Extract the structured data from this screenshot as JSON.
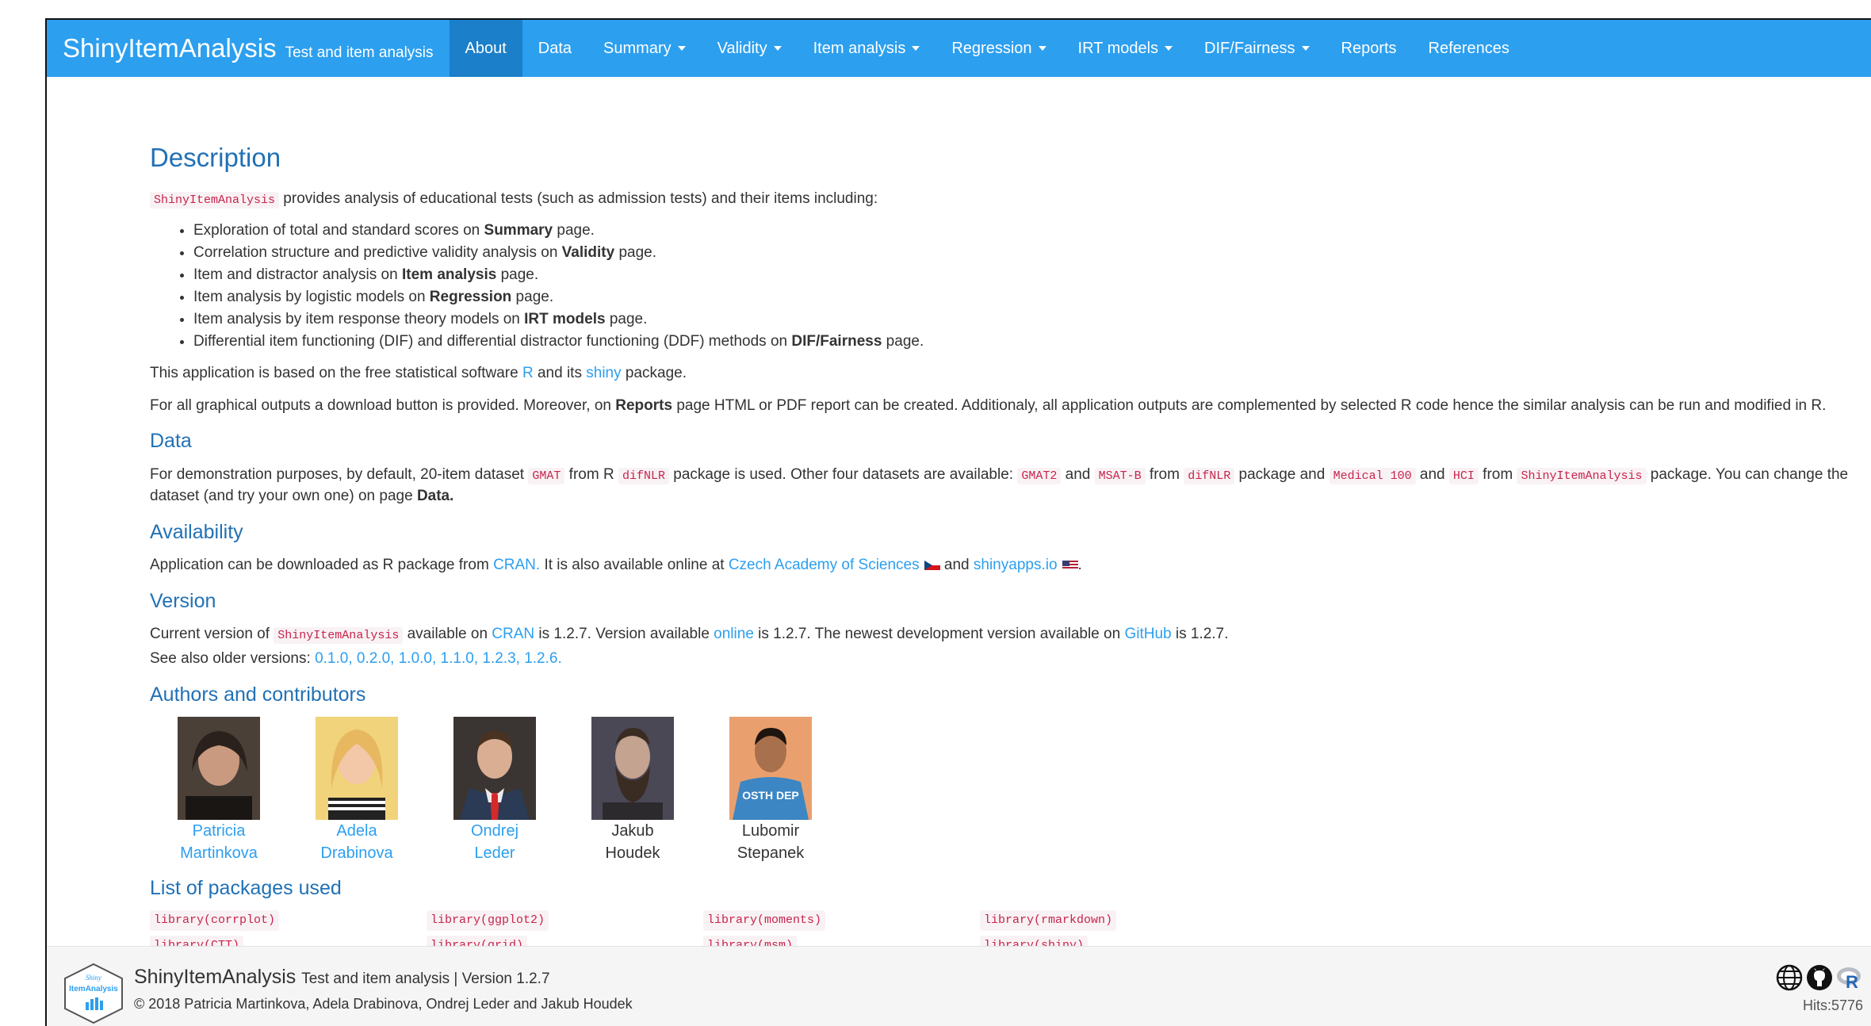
{
  "navbar": {
    "brand": "ShinyItemAnalysis",
    "tagline": "Test and item analysis",
    "items": [
      {
        "label": "About",
        "active": true,
        "dropdown": false
      },
      {
        "label": "Data",
        "active": false,
        "dropdown": false
      },
      {
        "label": "Summary",
        "active": false,
        "dropdown": true
      },
      {
        "label": "Validity",
        "active": false,
        "dropdown": true
      },
      {
        "label": "Item analysis",
        "active": false,
        "dropdown": true
      },
      {
        "label": "Regression",
        "active": false,
        "dropdown": true
      },
      {
        "label": "IRT models",
        "active": false,
        "dropdown": true
      },
      {
        "label": "DIF/Fairness",
        "active": false,
        "dropdown": true
      },
      {
        "label": "Reports",
        "active": false,
        "dropdown": false
      },
      {
        "label": "References",
        "active": false,
        "dropdown": false
      }
    ]
  },
  "description": {
    "heading": "Description",
    "intro_code": "ShinyItemAnalysis",
    "intro_text": " provides analysis of educational tests (such as admission tests) and their items including:",
    "features": [
      {
        "pre": "Exploration of total and standard scores on ",
        "bold": "Summary",
        "post": " page."
      },
      {
        "pre": "Correlation structure and predictive validity analysis on ",
        "bold": "Validity",
        "post": " page."
      },
      {
        "pre": "Item and distractor analysis on ",
        "bold": "Item analysis",
        "post": " page."
      },
      {
        "pre": "Item analysis by logistic models on ",
        "bold": "Regression",
        "post": " page."
      },
      {
        "pre": "Item analysis by item response theory models on ",
        "bold": "IRT models",
        "post": " page."
      },
      {
        "pre": "Differential item functioning (DIF) and differential distractor functioning (DDF) methods on ",
        "bold": "DIF/Fairness",
        "post": " page."
      }
    ],
    "based_pre": "This application is based on the free statistical software ",
    "based_link_r": "R",
    "based_mid": " and its ",
    "based_link_shiny": "shiny",
    "based_post": " package.",
    "outputs_pre": "For all graphical outputs a download button is provided. Moreover, on ",
    "outputs_bold": "Reports",
    "outputs_post": " page HTML or PDF report can be created. Additionaly, all application outputs are complemented by selected R code hence the similar analysis can be run and modified in R."
  },
  "data_section": {
    "heading": "Data",
    "t1": "For demonstration purposes, by default, 20-item dataset ",
    "c1": "GMAT",
    "t2": " from R ",
    "c2": "difNLR",
    "t3": " package is used. Other four datasets are available: ",
    "c3": "GMAT2",
    "t4": " and ",
    "c4": "MSAT-B",
    "t5": " from ",
    "c5": "difNLR",
    "t6": " package and ",
    "c6": "Medical 100",
    "t7": " and ",
    "c7": "HCI",
    "t8": " from ",
    "c8": "ShinyItemAnalysis",
    "t9": " package. You can change the dataset (and try your own one) on page ",
    "bold": "Data."
  },
  "availability": {
    "heading": "Availability",
    "t1": "Application can be downloaded as R package from ",
    "link_cran": "CRAN.",
    "t2": " It is also available online at ",
    "link_czech": "Czech Academy of Sciences",
    "t3": " and ",
    "link_shinyapps": "shinyapps.io",
    "t4": "."
  },
  "version": {
    "heading": "Version",
    "t1": "Current version of ",
    "code": "ShinyItemAnalysis",
    "t2": " available on ",
    "link_cran": "CRAN",
    "t3": " is 1.2.7. Version available ",
    "link_online": "online",
    "t4": " is 1.2.7. The newest development version available on ",
    "link_github": "GitHub",
    "t5": " is 1.2.7.",
    "older_label": "See also older versions: ",
    "older": [
      "0.1.0,",
      "0.2.0,",
      "1.0.0,",
      "1.1.0,",
      "1.2.3,",
      "1.2.6."
    ]
  },
  "authors": {
    "heading": "Authors and contributors",
    "people": [
      {
        "first": "Patricia",
        "last": "Martinkova",
        "link": true
      },
      {
        "first": "Adela",
        "last": "Drabinova",
        "link": true
      },
      {
        "first": "Ondrej",
        "last": "Leder",
        "link": true
      },
      {
        "first": "Jakub",
        "last": "Houdek",
        "link": false
      },
      {
        "first": "Lubomir",
        "last": "Stepanek",
        "link": false
      }
    ]
  },
  "packages": {
    "heading": "List of packages used",
    "items": [
      "library(corrplot)",
      "library(ggplot2)",
      "library(moments)",
      "library(rmarkdown)",
      "library(CTT)",
      "library(grid)",
      "library(msm)",
      "library(shiny)"
    ]
  },
  "footer": {
    "title": "ShinyItemAnalysis",
    "subtitle": "Test and item analysis | Version 1.2.7",
    "copyright": "© 2018 Patricia Martinkova, Adela Drabinova, Ondrej Leder and Jakub Houdek",
    "hits": "Hits:5776",
    "logo_text_top": "Shiny",
    "logo_text_mid": "ItemAnalysis"
  },
  "colors": {
    "navbar": "#2c9fef",
    "navbar_active": "#1b7fc9",
    "heading": "#2171b5",
    "link": "#2c9fef",
    "code": "#c7254e"
  }
}
